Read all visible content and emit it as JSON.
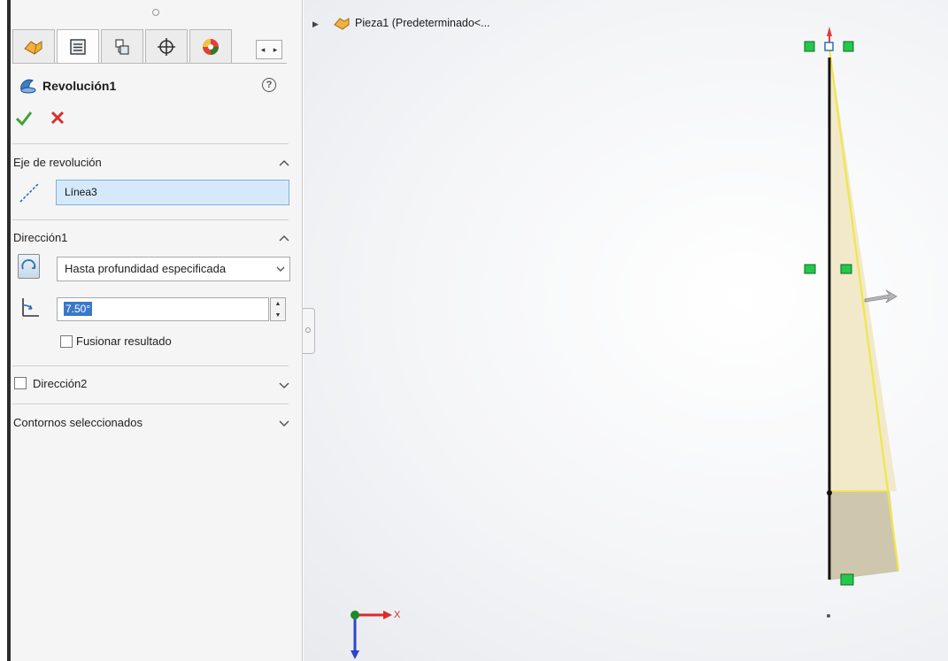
{
  "feature_panel": {
    "tabs": [
      "featuremanager-icon",
      "propertymanager-icon",
      "configurationmanager-icon",
      "dimxpert-icon",
      "display-manager-icon"
    ],
    "feature_name": "Revolución1",
    "sections": {
      "axis": {
        "title": "Eje de revolución",
        "value": "Línea3"
      },
      "direction1": {
        "title": "Dirección1",
        "type_selected": "Hasta profundidad especificada",
        "angle": "7.50°",
        "merge_label": "Fusionar resultado",
        "merge_checked": false
      },
      "direction2": {
        "title": "Dirección2",
        "checked": false
      },
      "selected_contours": {
        "title": "Contornos seleccionados"
      }
    }
  },
  "viewport": {
    "tree_label": "Pieza1  (Predeterminado<...",
    "triad_x_label": "X",
    "preview_fill": "#efe7c4",
    "preview_fill_bottom": "#cfc6ae",
    "edge_color": "#f0e64a",
    "handle_color": "#22c94a",
    "axis_color": "#e23b3b"
  },
  "colors": {
    "ok": "#3aa53a",
    "cancel": "#d33131",
    "field_highlight": "#d6e9fb",
    "selection": "#3a78c9"
  }
}
